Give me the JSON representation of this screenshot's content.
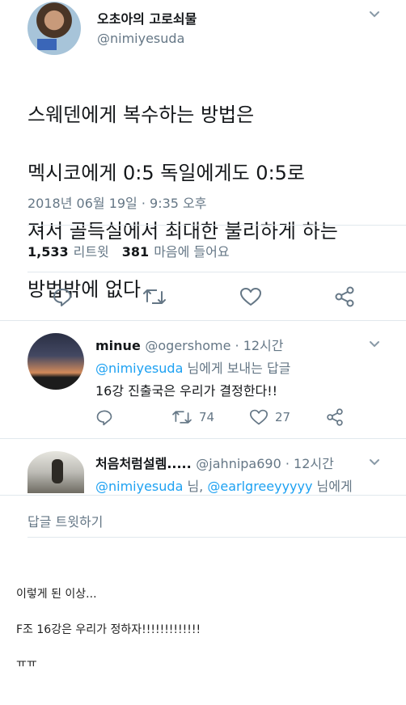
{
  "tweet": {
    "author_name": "오초아의 고로쇠물",
    "author_handle": "@nimiyesuda",
    "text_lines": [
      "스웨덴에게 복수하는 방법은",
      "멕시코에게 0:5 독일에게도 0:5로",
      "져서 골득실에서 최대한 불리하게 하는",
      "방법밖에 없다"
    ],
    "timestamp": "2018년 06월 19일 · 9:35 오후",
    "retweets": "1,533",
    "retweets_label": "리트윗",
    "likes": "381",
    "likes_label": "마음에 들어요"
  },
  "replies": [
    {
      "name": "minue",
      "handle": "@ogershome · 12시간",
      "reply_to_mention": "@nimiyesuda",
      "reply_to_suffix": " 님에게 보내는 답글",
      "text": "16강 진출국은 우리가 결정한다!!",
      "retweets": "74",
      "likes": "27"
    },
    {
      "name": "처음처럼설렘.....",
      "handle": "@jahnipa690 · 12시간",
      "mention1": "@nimiyesuda",
      "separator": " 님, ",
      "mention2": "@earlgreeyyyyy",
      "suffix": " 님에게"
    }
  ],
  "reply_prompt": "답글 트윗하기",
  "post": {
    "line1": "이렇게 된 이상...",
    "line2": "F조 16강은 우리가 정하자!!!!!!!!!!!!!",
    "line3": "ㅠㅠ"
  },
  "icons": {
    "reply": "reply-icon",
    "retweet": "retweet-icon",
    "like": "heart-icon",
    "share": "share-icon",
    "menu": "chevron-down-icon"
  },
  "colors": {
    "accent": "#1da1f2",
    "secondary_text": "#657786",
    "divider": "#e1e8ed"
  }
}
